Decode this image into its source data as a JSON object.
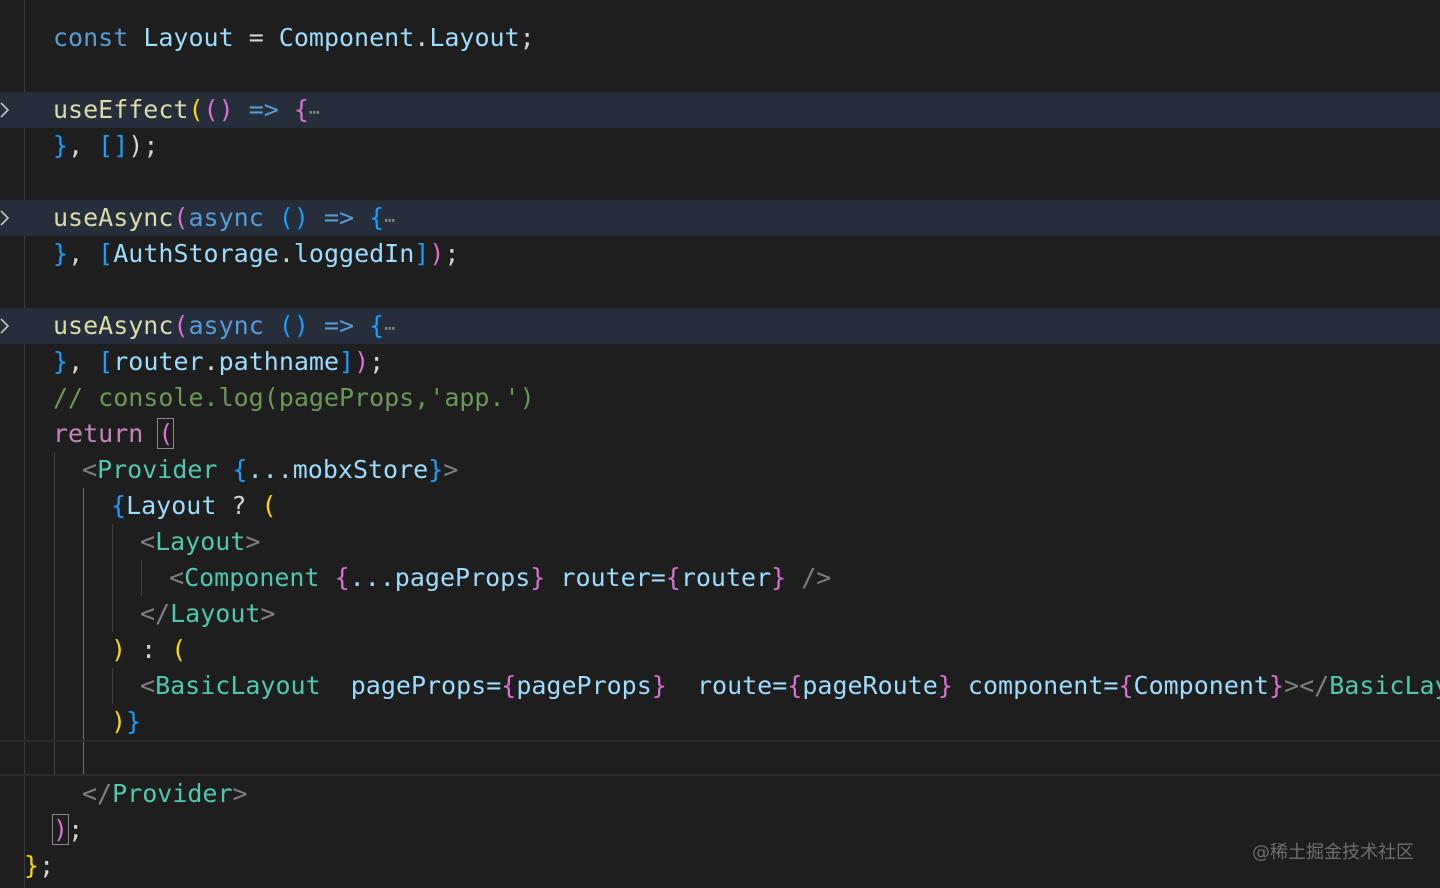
{
  "editor": {
    "theme_background": "#1e1e1e",
    "watermark": "@稀土掘金技术社区",
    "lines": {
      "l1": {
        "kw": "const",
        "name": "Layout",
        "eq": " = ",
        "obj": "Component",
        "dot": ".",
        "prop": "Layout",
        "end": ";"
      },
      "l2": {
        "fn": "useEffect",
        "open": "(",
        "params": "()",
        "arrow": " => ",
        "brace": "{",
        "dots": "⋯"
      },
      "l3": {
        "close": "}",
        "sep": ", ",
        "deps": "[]",
        "end": ");"
      },
      "l4": {
        "fn": "useAsync",
        "open": "(",
        "kw": "async",
        "params": " ()",
        "arrow": " => ",
        "brace": "{",
        "dots": "⋯"
      },
      "l5": {
        "close": "}",
        "sep": ", ",
        "open_br": "[",
        "obj": "AuthStorage",
        "dot": ".",
        "prop": "loggedIn",
        "close_br": "]",
        "paren": ")",
        "end": ";"
      },
      "l6": {
        "fn": "useAsync",
        "open": "(",
        "kw": "async",
        "params": " ()",
        "arrow": " => ",
        "brace": "{",
        "dots": "⋯"
      },
      "l7": {
        "close": "}",
        "sep": ", ",
        "open_br": "[",
        "obj": "router",
        "dot": ".",
        "prop": "pathname",
        "close_br": "]",
        "paren": ")",
        "end": ";"
      },
      "l8": {
        "comment": "// console.log(pageProps,'app.')"
      },
      "l9": {
        "kw": "return",
        "paren": "("
      },
      "l10": {
        "lt": "<",
        "tag": "Provider",
        "open": " {",
        "spread": "...mobxStore",
        "close": "}",
        "gt": ">"
      },
      "l11": {
        "open": "{",
        "name": "Layout",
        "op": " ? ",
        "paren": "("
      },
      "l12": {
        "lt": "<",
        "tag": "Layout",
        "gt": ">"
      },
      "l13": {
        "lt": "<",
        "tag": "Component",
        "sp": " ",
        "open": "{",
        "spread": "...pageProps",
        "close": "}",
        "attr": " router=",
        "aopen": "{",
        "aval": "router",
        "aclose": "}",
        "end": " />"
      },
      "l14": {
        "lt": "</",
        "tag": "Layout",
        "gt": ">"
      },
      "l15": {
        "close": ")",
        "op": " : ",
        "open": "("
      },
      "l16": {
        "lt": "<",
        "tag": "BasicLayout",
        "a1": "  pageProps=",
        "o1": "{",
        "v1": "pageProps",
        "c1": "}",
        "a2": "  route=",
        "o2": "{",
        "v2": "pageRoute",
        "c2": "}",
        "a3": " component=",
        "o3": "{",
        "v3": "Component",
        "c3": "}",
        "gt": ">",
        "lt2": "</",
        "tag2": "BasicLayout"
      },
      "l17": {
        "paren": ")",
        "brace": "}"
      },
      "l19": {
        "lt": "</",
        "tag": "Provider",
        "gt": ">"
      },
      "l20": {
        "paren": ")",
        "end": ";"
      },
      "l21": {
        "brace": "}",
        "end": ";"
      }
    }
  }
}
